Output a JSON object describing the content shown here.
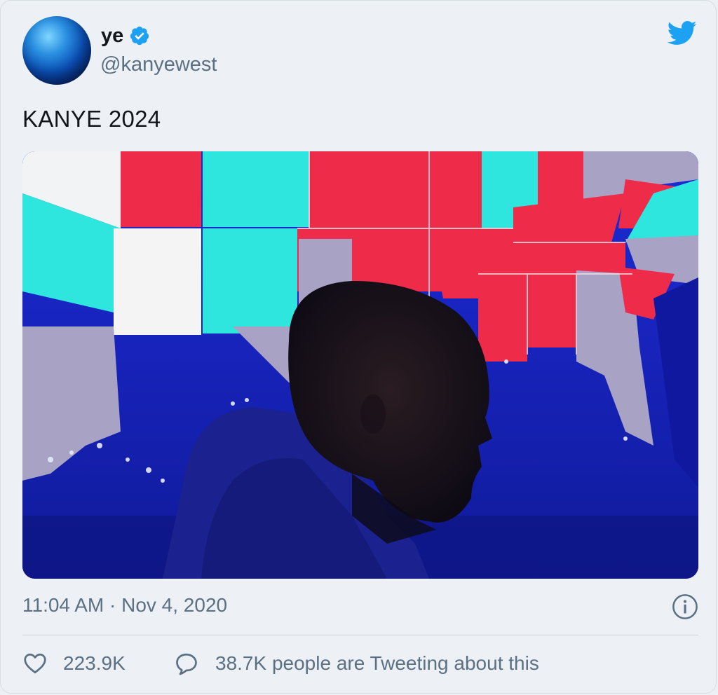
{
  "tweet": {
    "author": {
      "display_name": "ye",
      "handle": "@kanyewest",
      "verified": true,
      "avatar_icon": "blue-globe-avatar"
    },
    "text": "KANYE 2024",
    "media": {
      "kind": "photo",
      "subject": "silhouette in front of election map"
    },
    "timestamp": "11:04 AM · Nov 4, 2020",
    "likes": "223.9K",
    "tweeting_about": "38.7K people are Tweeting about this"
  },
  "icons": {
    "brand": "twitter-bird-icon",
    "verified": "verified-badge-icon",
    "info": "info-icon",
    "like": "heart-icon",
    "reply": "speech-bubble-icon"
  },
  "colors": {
    "brand_blue": "#1da1f2",
    "secondary_text": "#5b7083",
    "primary_text": "#14171a",
    "card_bg": "#edf1f5"
  }
}
